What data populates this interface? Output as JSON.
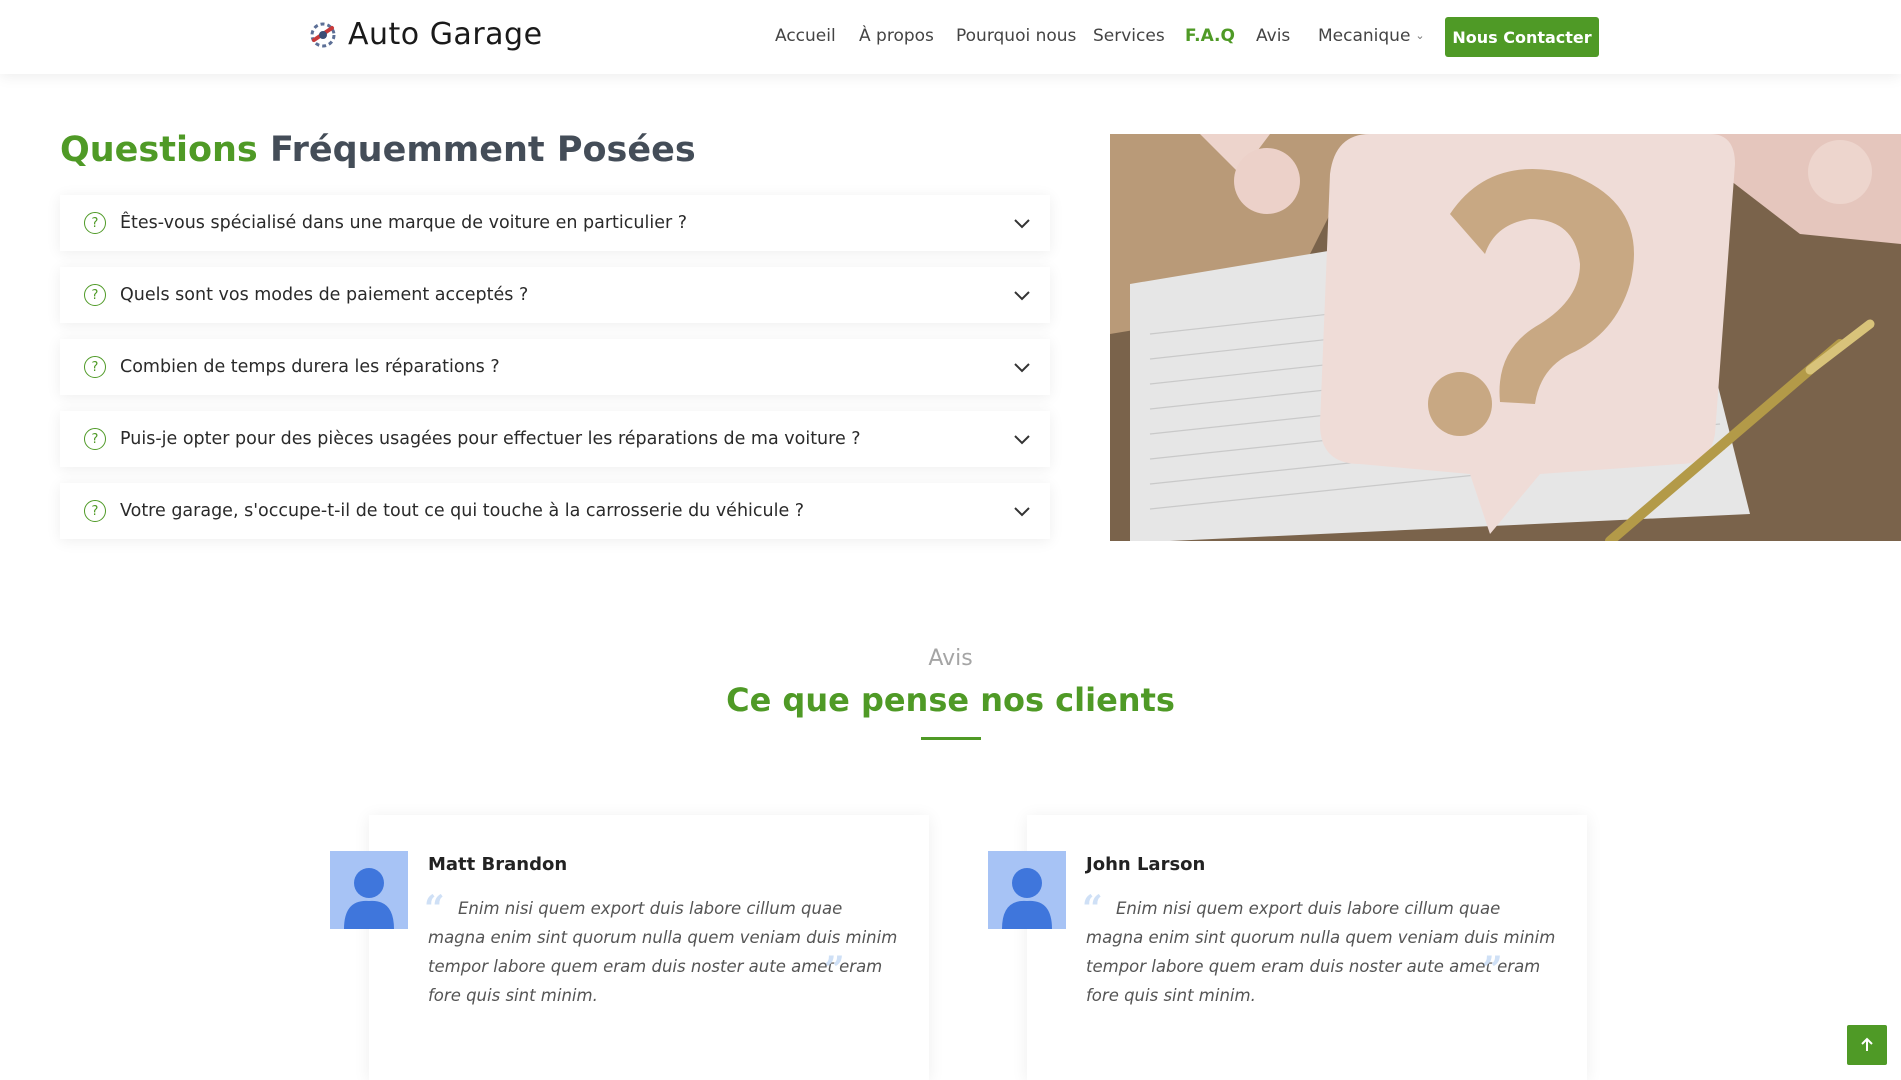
{
  "brand": {
    "name": "Auto Garage"
  },
  "nav": {
    "items": [
      {
        "label": "Accueil"
      },
      {
        "label": "À propos"
      },
      {
        "label": "Pourquoi nous"
      },
      {
        "label": "Services"
      },
      {
        "label": "F.A.Q"
      },
      {
        "label": "Avis"
      },
      {
        "label": "Mecanique"
      }
    ],
    "cta": "Nous Contacter",
    "active": "F.A.Q"
  },
  "faq": {
    "title_accent": "Questions",
    "title_rest": " Fréquemment Posées",
    "items": [
      {
        "question": "Êtes-vous spécialisé dans une marque de voiture en particulier ?"
      },
      {
        "question": "Quels sont vos modes de paiement acceptés ?"
      },
      {
        "question": "Combien de temps durera les réparations ?"
      },
      {
        "question": "Puis-je opter pour des pièces usagées pour effectuer les réparations de ma voiture ?"
      },
      {
        "question": "Votre garage, s'occupe-t-il de tout ce qui touche à la carrosserie du véhicule ?"
      }
    ]
  },
  "testimonials": {
    "subtitle": "Avis",
    "title": "Ce que pense nos clients",
    "items": [
      {
        "name": "Matt Brandon",
        "quote": "Enim nisi quem export duis labore cillum quae magna enim sint quorum nulla quem veniam duis minim tempor labore quem eram duis noster aute amet eram fore quis sint minim."
      },
      {
        "name": "John Larson",
        "quote": "Enim nisi quem export duis labore cillum quae magna enim sint quorum nulla quem veniam duis minim tempor labore quem eram duis noster aute amet eram fore quis sint minim."
      }
    ]
  },
  "colors": {
    "accent": "#4f9a26",
    "text": "#333333",
    "muted": "#a5a5a5"
  },
  "icons": {
    "faq": "question-circle-icon",
    "expand": "chevron-down-icon",
    "back_to_top": "arrow-up-icon"
  }
}
